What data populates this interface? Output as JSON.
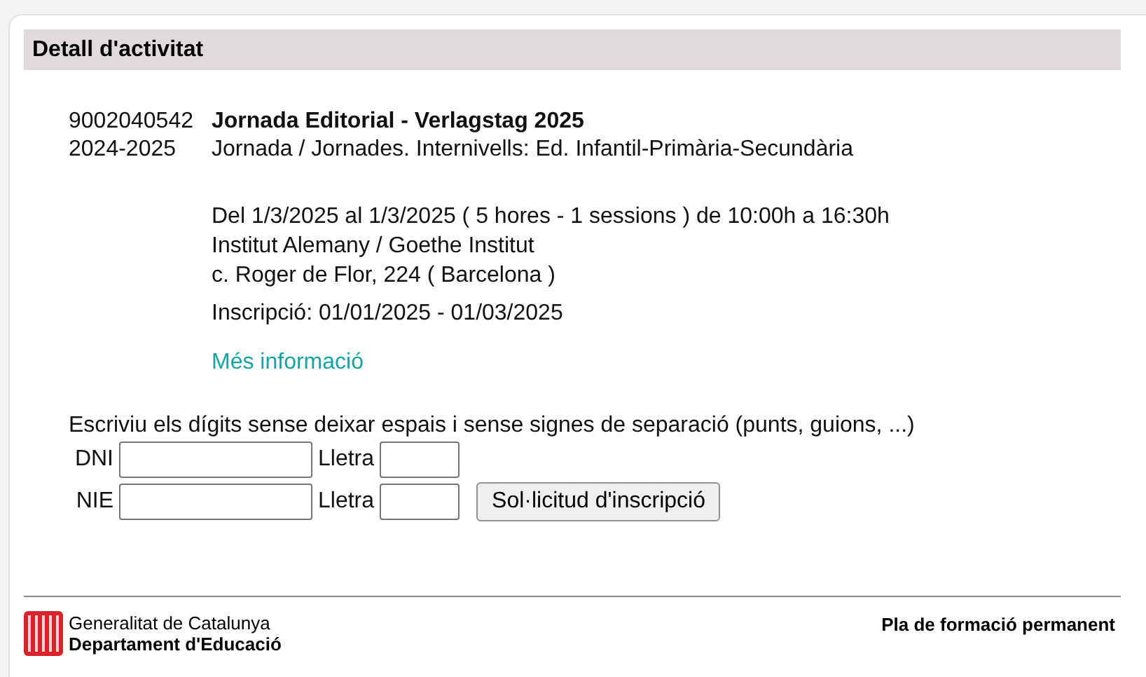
{
  "panel": {
    "title": "Detall d'activitat"
  },
  "activity": {
    "code": "9002040542",
    "title": "Jornada Editorial - Verlagstag 2025",
    "year": "2024-2025",
    "type": "Jornada / Jornades. Internivells: Ed. Infantil-Primària-Secundària",
    "schedule": "Del 1/3/2025 al 1/3/2025 ( 5 hores - 1 sessions ) de 10:00h a 16:30h",
    "venue": "Institut Alemany / Goethe Institut",
    "address": "c. Roger de Flor, 224 ( Barcelona )",
    "enrollment": "Inscripció: 01/01/2025 - 01/03/2025",
    "more_link": "Més informació"
  },
  "form": {
    "instructions": "Escriviu els dígits sense deixar espais i sense signes de separació (punts, guions, ...)",
    "rows": [
      {
        "label": "DNI",
        "letter_label": "Lletra"
      },
      {
        "label": "NIE",
        "letter_label": "Lletra"
      }
    ],
    "submit": "Sol·licitud d'inscripció"
  },
  "footer": {
    "org": "Generalitat de Catalunya",
    "department": "Departament d'Educació",
    "program": "Pla de formació permanent"
  }
}
